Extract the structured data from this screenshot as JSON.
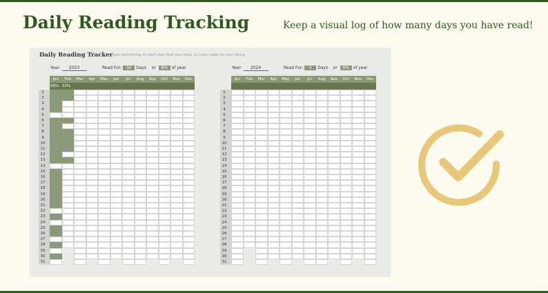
{
  "page": {
    "title": "Daily Reading Tracking",
    "subtitle": "Keep a visual log of how many days you have read!"
  },
  "sheet": {
    "title": "Daily Reading Tracker",
    "hint": "Type something in each day that you read, or color code to your liking.",
    "labels": {
      "year": "Year:",
      "read_for": "Read For:",
      "days": "Days",
      "or": "or",
      "of_year": "of year"
    },
    "trackers": [
      {
        "year": "2023",
        "days": "30",
        "pct": "8%"
      },
      {
        "year": "2024",
        "days": "0",
        "pct": "0%"
      }
    ],
    "months": [
      "Jan",
      "Feb",
      "Mar",
      "Apr",
      "May",
      "Jun",
      "Jul",
      "Aug",
      "Sep",
      "Oct",
      "Nov",
      "Dec"
    ],
    "day_numbers": [
      "1",
      "2",
      "3",
      "4",
      "5",
      "6",
      "7",
      "8",
      "9",
      "10",
      "11",
      "12",
      "13",
      "14",
      "15",
      "16",
      "17",
      "18",
      "19",
      "20",
      "21",
      "22",
      "23",
      "24",
      "25",
      "26",
      "27",
      "28",
      "29",
      "30",
      "31"
    ],
    "days_in_month": [
      31,
      28,
      31,
      30,
      31,
      30,
      31,
      31,
      30,
      31,
      30,
      31
    ],
    "month_percent_2023": [
      "68%",
      "32%"
    ],
    "read_days_2023": {
      "Jan": [
        1,
        2,
        3,
        4,
        6,
        7,
        8,
        9,
        10,
        11,
        12,
        13,
        15,
        16,
        17,
        18,
        19,
        20,
        21,
        23,
        25,
        26,
        28,
        30
      ],
      "Feb": [
        1,
        2,
        6,
        8,
        9,
        10,
        11,
        13
      ]
    }
  },
  "colors": {
    "brand_green": "#2f5a1f",
    "header_green": "#8a9a78",
    "percent_row": "#69794e",
    "background": "#fdfbef",
    "check_gold": "#e8c878"
  },
  "icons": {
    "check": "check-circle-icon"
  }
}
